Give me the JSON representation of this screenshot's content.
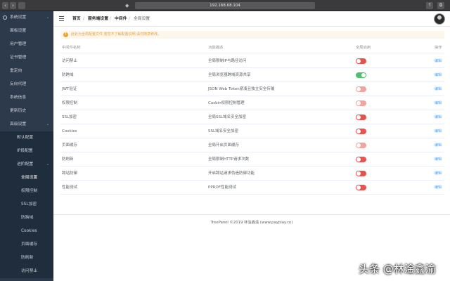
{
  "browser": {
    "url": "192.168.68.104",
    "back": "‹",
    "forward": "›"
  },
  "sidebar": {
    "items": [
      {
        "label": "系统设置",
        "level": 0,
        "caret": "⌄"
      },
      {
        "label": "面板设置",
        "level": 0
      },
      {
        "label": "用户管理",
        "level": 0
      },
      {
        "label": "证书管理",
        "level": 0
      },
      {
        "label": "重定向",
        "level": 0
      },
      {
        "label": "反向代理",
        "level": 0
      },
      {
        "label": "系统信息",
        "level": 0
      },
      {
        "label": "更新历史",
        "level": 0
      },
      {
        "label": "高级设置",
        "level": 0,
        "caret": "⌄"
      },
      {
        "label": "默认配置",
        "level": 1
      },
      {
        "label": "IP段配置",
        "level": 1
      },
      {
        "label": "进阶配置",
        "level": 1,
        "caret": "⌄"
      },
      {
        "label": "全局设置",
        "level": 2,
        "active": true
      },
      {
        "label": "权限控制",
        "level": 2
      },
      {
        "label": "SSL加密",
        "level": 2
      },
      {
        "label": "防跨域",
        "level": 2
      },
      {
        "label": "Cookies",
        "level": 2
      },
      {
        "label": "页面缓存",
        "level": 2
      },
      {
        "label": "防刷新",
        "level": 2
      },
      {
        "label": "访问禁止",
        "level": 2
      }
    ]
  },
  "breadcrumb": {
    "items": [
      "首页",
      "服务端设置",
      "中间件",
      "全局设置"
    ],
    "sep": "/"
  },
  "alert": {
    "icon": "!",
    "text": "此处为全局配置文件,若您不了解配置说明,请勿随意修改。"
  },
  "table": {
    "headers": {
      "name": "中间件名称",
      "desc": "功能描述",
      "enabled": "全局启用",
      "op": "操作"
    },
    "rows": [
      {
        "name": "访问禁止",
        "desc": "全局限制IP与路径访问",
        "state": "off",
        "op": "编辑"
      },
      {
        "name": "防跨域",
        "desc": "全局浏览器跨域资源共享",
        "state": "on",
        "op": "编辑"
      },
      {
        "name": "JWT验证",
        "desc": "JSON Web Token紧凑且独立安全传输",
        "state": "soft",
        "op": "编辑"
      },
      {
        "name": "权限控制",
        "desc": "Casbin权限控制管理",
        "state": "soft",
        "op": "编辑"
      },
      {
        "name": "SSL加密",
        "desc": "全局SSL域名安全加密",
        "state": "off",
        "op": "编辑"
      },
      {
        "name": "Cookies",
        "desc": "SSL域名安全加密",
        "state": "off",
        "op": "编辑"
      },
      {
        "name": "页面缓存",
        "desc": "全局开启页面缓存",
        "state": "soft",
        "op": "编辑"
      },
      {
        "name": "防刷新",
        "desc": "全局限制HTTP请求次数",
        "state": "off",
        "op": "编辑"
      },
      {
        "name": "跨站防御",
        "desc": "开启跨站请求伪造防御功能",
        "state": "off",
        "op": "编辑"
      },
      {
        "name": "性能测试",
        "desc": "PPROF性能测试",
        "state": "off",
        "op": "编辑"
      }
    ]
  },
  "footer": {
    "text": "TreePanel ©2019 林淦鑫渝 (www.payplay.cn)"
  },
  "watermark": {
    "text": "头条 @林淦鑫渝"
  },
  "colors": {
    "sidebar_bg": "#2d3a4b",
    "switch_off": "#e9534f",
    "switch_on": "#51c16f",
    "link": "#409eff",
    "warning": "#e6a23c"
  }
}
